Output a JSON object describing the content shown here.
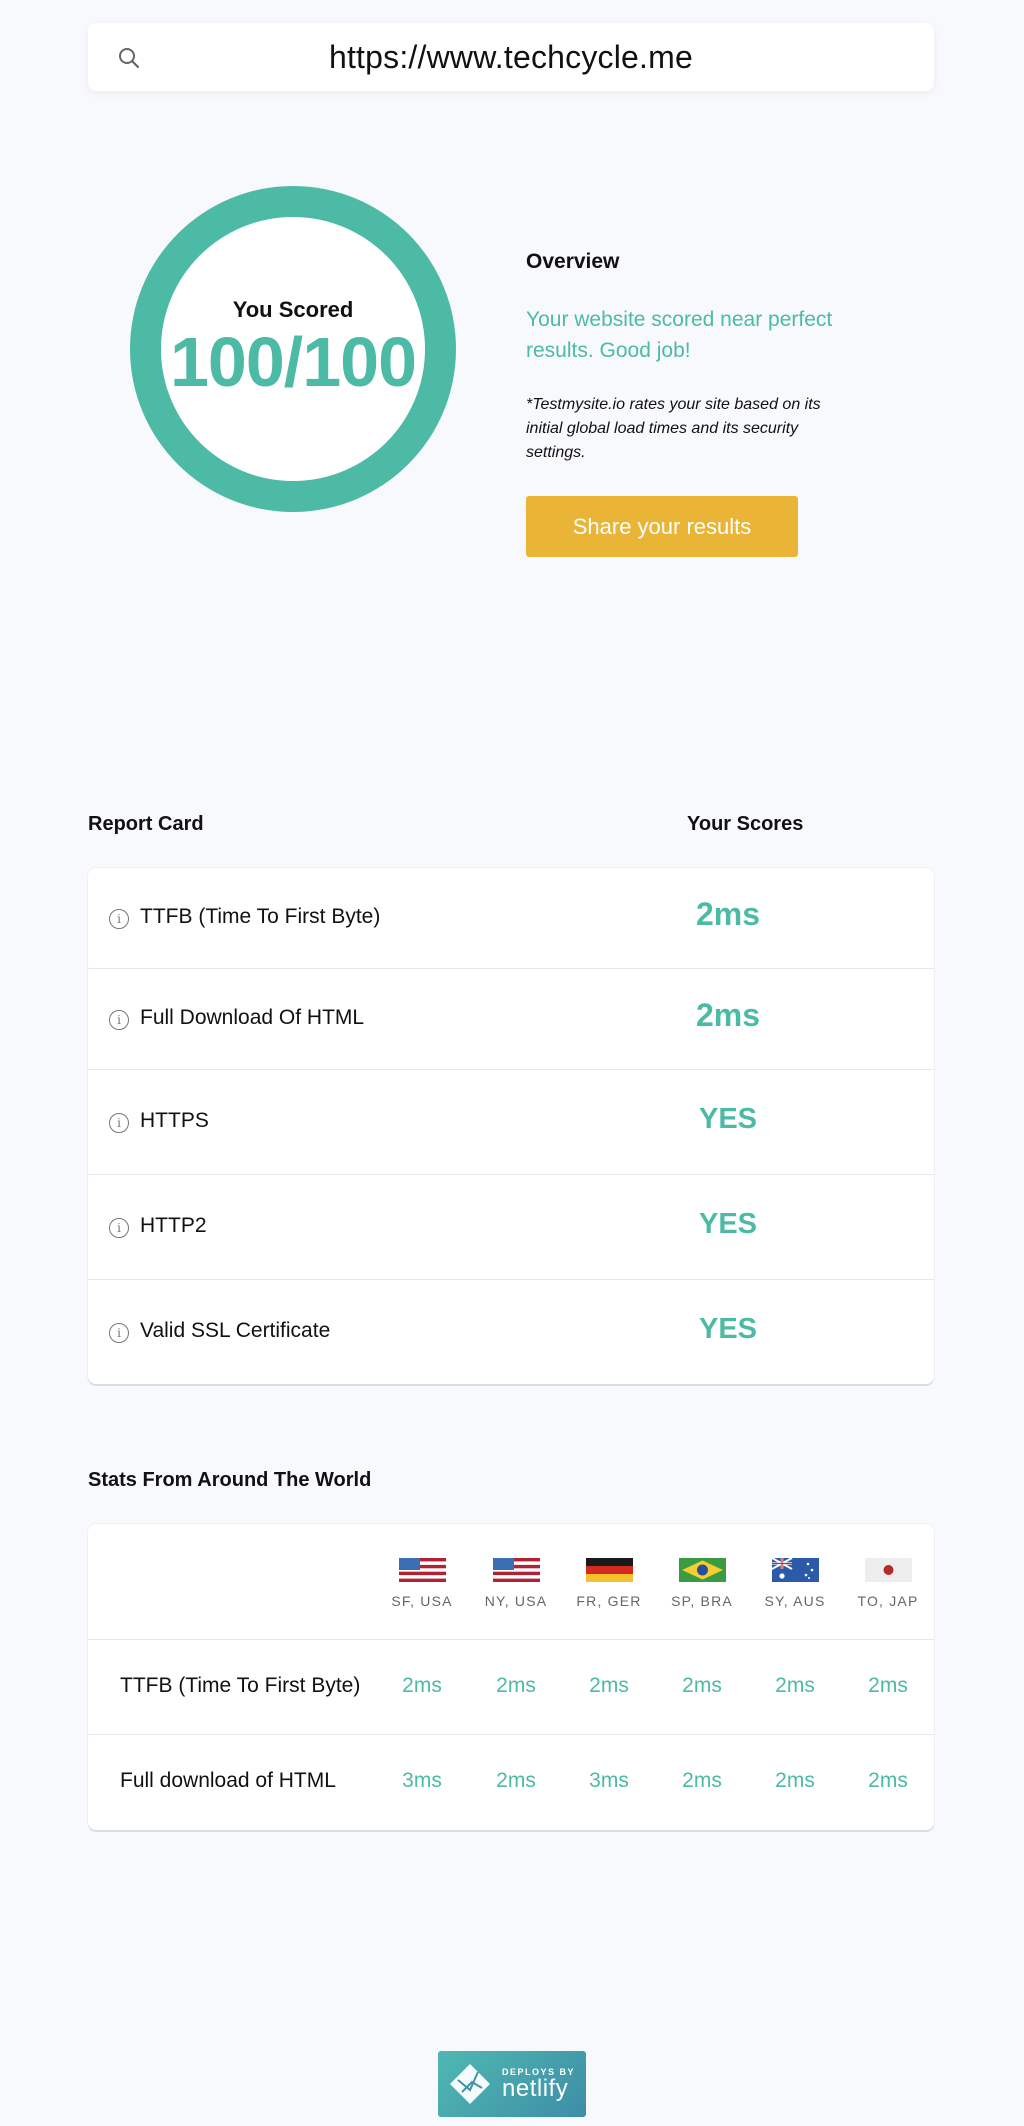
{
  "search": {
    "url": "https://www.techcycle.me",
    "icon": "search-icon"
  },
  "score": {
    "label": "You Scored",
    "value": "100/100",
    "ring_color": "#4dbaa5"
  },
  "overview": {
    "title": "Overview",
    "message": "Your website scored near perfect results. Good job!",
    "note": "*Testmysite.io rates your site based on its initial global load times and its security settings.",
    "share_label": "Share your results",
    "share_color": "#eab536"
  },
  "report_card": {
    "title": "Report Card",
    "scores_title": "Your Scores",
    "rows": [
      {
        "label": "TTFB (Time To First Byte)",
        "value": "2ms"
      },
      {
        "label": "Full Download Of HTML",
        "value": "2ms"
      },
      {
        "label": "HTTPS",
        "value": "YES"
      },
      {
        "label": "HTTP2",
        "value": "YES"
      },
      {
        "label": "Valid SSL Certificate",
        "value": "YES"
      }
    ]
  },
  "stats": {
    "title": "Stats From Around The World",
    "locations": [
      "SF, USA",
      "NY, USA",
      "FR, GER",
      "SP, BRA",
      "SY, AUS",
      "TO, JAP"
    ],
    "rows": [
      {
        "label": "TTFB (Time To First Byte)",
        "values": [
          "2ms",
          "2ms",
          "2ms",
          "2ms",
          "2ms",
          "2ms"
        ]
      },
      {
        "label": "Full download of HTML",
        "values": [
          "3ms",
          "2ms",
          "3ms",
          "2ms",
          "2ms",
          "2ms"
        ]
      }
    ]
  },
  "footer": {
    "badge_small": "DEPLOYS BY",
    "badge_big": "netlify"
  },
  "colors": {
    "accent": "#4dbaa5",
    "background": "#f8f9fd"
  }
}
